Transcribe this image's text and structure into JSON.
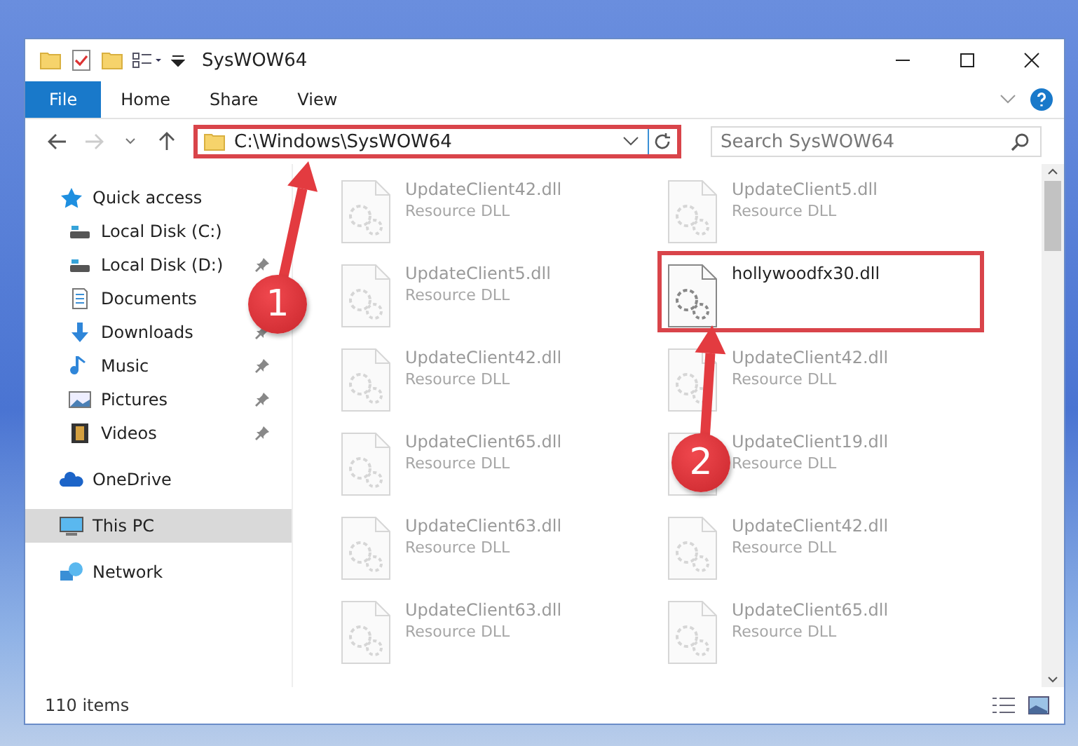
{
  "window": {
    "title": "SysWOW64"
  },
  "ribbon": {
    "tabs": [
      {
        "label": "File",
        "selected": true
      },
      {
        "label": "Home",
        "selected": false
      },
      {
        "label": "Share",
        "selected": false
      },
      {
        "label": "View",
        "selected": false
      }
    ]
  },
  "address_bar": {
    "path": "C:\\Windows\\SysWOW64",
    "highlighted": true
  },
  "search": {
    "placeholder": "Search SysWOW64"
  },
  "sidebar": {
    "items": [
      {
        "label": "Quick access",
        "kind": "star",
        "selected": false,
        "pinned": false,
        "children": [
          {
            "label": "Local Disk (C:)",
            "kind": "disk",
            "selected": false,
            "pinned": false
          },
          {
            "label": "Local Disk (D:)",
            "kind": "disk",
            "selected": false,
            "pinned": true
          },
          {
            "label": "Documents",
            "kind": "document",
            "selected": false
          },
          {
            "label": "Downloads",
            "kind": "download",
            "selected": false,
            "pinned": true
          },
          {
            "label": "Music",
            "kind": "music",
            "selected": false,
            "pinned": true
          },
          {
            "label": "Pictures",
            "kind": "pictures",
            "selected": false,
            "pinned": true
          },
          {
            "label": "Videos",
            "kind": "video",
            "selected": false,
            "pinned": true
          }
        ]
      },
      {
        "label": "OneDrive",
        "kind": "cloud",
        "selected": false,
        "pinned": false
      },
      {
        "label": "This PC",
        "kind": "pc",
        "selected": true,
        "pinned": false
      },
      {
        "label": "Network",
        "kind": "network",
        "selected": false,
        "pinned": false
      }
    ]
  },
  "files": [
    {
      "name": "UpdateClient42.dll",
      "type": "Resource DLL",
      "blurred": true,
      "highlighted": false
    },
    {
      "name": "UpdateClient5.dll",
      "type": "Resource DLL",
      "blurred": true,
      "highlighted": false
    },
    {
      "name": "UpdateClient5.dll",
      "type": "Resource DLL",
      "blurred": true,
      "highlighted": false
    },
    {
      "name": "hollywoodfx30.dll",
      "blurred": false,
      "highlighted": true
    },
    {
      "name": "UpdateClient42.dll",
      "type": "Resource DLL",
      "blurred": true,
      "highlighted": false
    },
    {
      "name": "UpdateClient42.dll",
      "type": "Resource DLL",
      "blurred": true,
      "highlighted": false
    },
    {
      "name": "UpdateClient65.dll",
      "type": "Resource DLL",
      "blurred": true,
      "highlighted": false
    },
    {
      "name": "UpdateClient19.dll",
      "type": "Resource DLL",
      "blurred": true,
      "highlighted": false
    },
    {
      "name": "UpdateClient63.dll",
      "type": "Resource DLL",
      "blurred": true,
      "highlighted": false
    },
    {
      "name": "UpdateClient42.dll",
      "type": "Resource DLL",
      "blurred": true,
      "highlighted": false
    },
    {
      "name": "UpdateClient63.dll",
      "type": "Resource DLL",
      "blurred": true,
      "highlighted": false
    },
    {
      "name": "UpdateClient65.dll",
      "type": "Resource DLL",
      "blurred": true,
      "highlighted": false
    }
  ],
  "status_bar": {
    "item_count": "110 items"
  },
  "annotations": [
    {
      "label": "1"
    },
    {
      "label": "2"
    }
  ]
}
